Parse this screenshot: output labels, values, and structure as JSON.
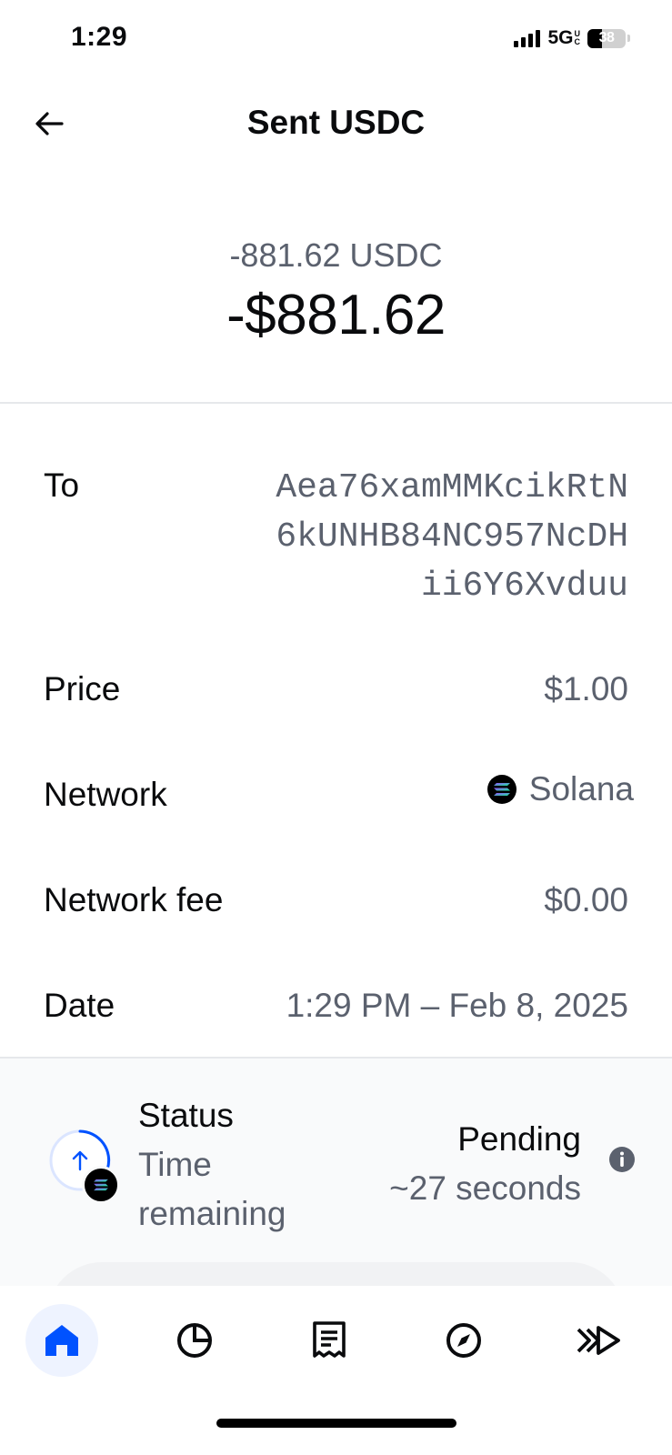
{
  "status_bar": {
    "time": "1:29",
    "network": "5G",
    "network_badge": "UC",
    "battery": "38",
    "battery_level": 0.38
  },
  "header": {
    "title": "Sent USDC",
    "back_icon": "arrow-left-icon"
  },
  "amount": {
    "crypto": "-881.62 USDC",
    "fiat": "-$881.62"
  },
  "details": {
    "to_label": "To",
    "to_address_lines": [
      "Aea76xamMMKcikRtN",
      "6kUNHB84NC957NcDH",
      "ii6Y6Xvduu"
    ],
    "price_label": "Price",
    "price_value": "$1.00",
    "network_label": "Network",
    "network_value": "Solana",
    "network_icon": "solana-icon",
    "fee_label": "Network fee",
    "fee_value": "$0.00",
    "date_label": "Date",
    "date_value": "1:29 PM – Feb 8, 2025"
  },
  "status": {
    "title": "Status",
    "time_remaining_line1": "Time",
    "time_remaining_line2": "remaining",
    "state": "Pending",
    "eta": "~27 seconds",
    "icon": "send-progress-icon",
    "info_icon": "info-icon"
  },
  "nav": {
    "items": [
      "home-icon",
      "portfolio-icon",
      "transactions-icon",
      "explore-icon",
      "trade-icon"
    ],
    "active": "home-icon"
  },
  "colors": {
    "primary_text": "#0a0b0d",
    "secondary_text": "#5b616e",
    "accent": "#0052ff",
    "divider": "#e6e8eb"
  }
}
